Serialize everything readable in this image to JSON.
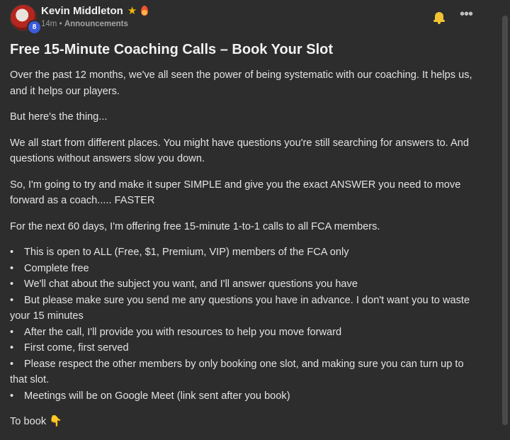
{
  "author": {
    "name": "Kevin Middleton",
    "level": "8",
    "time": "14m",
    "category": "Announcements",
    "separator": "•"
  },
  "icons": {
    "star": "★",
    "more": "•••",
    "pointer": "👇"
  },
  "colors": {
    "background": "#2d2d2d",
    "level_badge": "#3b5bdb",
    "star": "#f2b705",
    "bell": "#f2c233"
  },
  "post": {
    "title": "Free 15-Minute Coaching Calls – Book Your Slot",
    "paragraphs": [
      "Over the past 12 months, we've all seen the power of being systematic with our coaching. It helps us, and it helps our players.",
      "But here's the thing...",
      "We all start from different places. You might have questions you're still searching for answers to. And questions without answers slow you down.",
      "So, I'm going to try and make it super SIMPLE and give you the exact ANSWER you need to move forward as a coach..... FASTER",
      "For the next 60 days, I'm offering free 15-minute 1-to-1 calls to all FCA members."
    ],
    "bullets": [
      "This is open to ALL (Free, $1, Premium, VIP) members of the FCA only",
      "Complete free",
      "We'll chat about the subject you want, and I'll answer questions you have",
      "But please make sure you send me any questions you have in advance. I don't want you to waste your 15 minutes",
      "After the call, I'll provide you with resources to help you move forward",
      "First come, first served",
      "Please respect the other members by only booking one slot, and making sure you can turn up to that slot.",
      "Meetings will be on Google Meet (link sent after you book)"
    ],
    "closing": "To book"
  }
}
